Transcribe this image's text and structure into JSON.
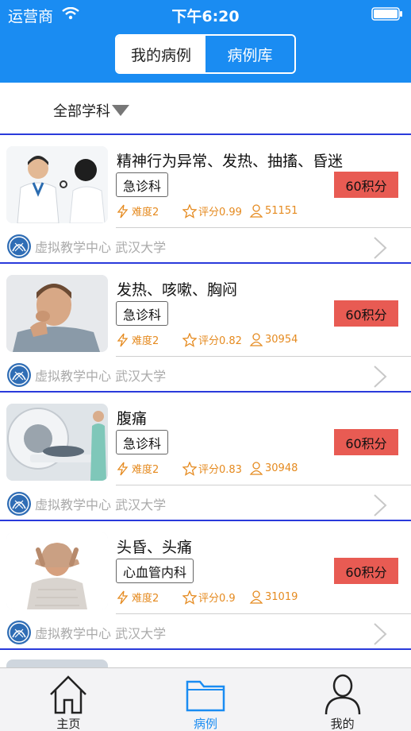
{
  "status_bar": {
    "carrier": "运营商",
    "time": "下午6:20"
  },
  "segmented": {
    "tabs": [
      {
        "label": "我的病例",
        "active": true
      },
      {
        "label": "病例库",
        "active": false
      }
    ]
  },
  "filter": {
    "label": "全部学科"
  },
  "colors": {
    "primary": "#1a8cf2",
    "accent": "#e85b53",
    "stat": "#e58a1f",
    "divider": "#2a3adb"
  },
  "cases": [
    {
      "title": "精神行为异常、发热、抽搐、昏迷",
      "department": "急诊科",
      "points": "60积分",
      "difficulty": "难度2",
      "score": "评分0.99",
      "users": "51151",
      "institution": "虚拟教学中心 武汉大学",
      "image": "doctor-patient"
    },
    {
      "title": "发热、咳嗽、胸闷",
      "department": "急诊科",
      "points": "60积分",
      "difficulty": "难度2",
      "score": "评分0.82",
      "users": "30954",
      "institution": "虚拟教学中心 武汉大学",
      "image": "coughing-man"
    },
    {
      "title": "腹痛",
      "department": "急诊科",
      "points": "60积分",
      "difficulty": "难度2",
      "score": "评分0.83",
      "users": "30948",
      "institution": "虚拟教学中心 武汉大学",
      "image": "ct-scan"
    },
    {
      "title": "头昏、头痛",
      "department": "心血管内科",
      "points": "60积分",
      "difficulty": "难度2",
      "score": "评分0.9",
      "users": "31019",
      "institution": "虚拟教学中心 武汉大学",
      "image": "headache-man"
    }
  ],
  "tabbar": {
    "items": [
      {
        "label": "主页",
        "icon": "home-icon",
        "active": false
      },
      {
        "label": "病例",
        "icon": "folder-icon",
        "active": true
      },
      {
        "label": "我的",
        "icon": "user-icon",
        "active": false
      }
    ]
  }
}
